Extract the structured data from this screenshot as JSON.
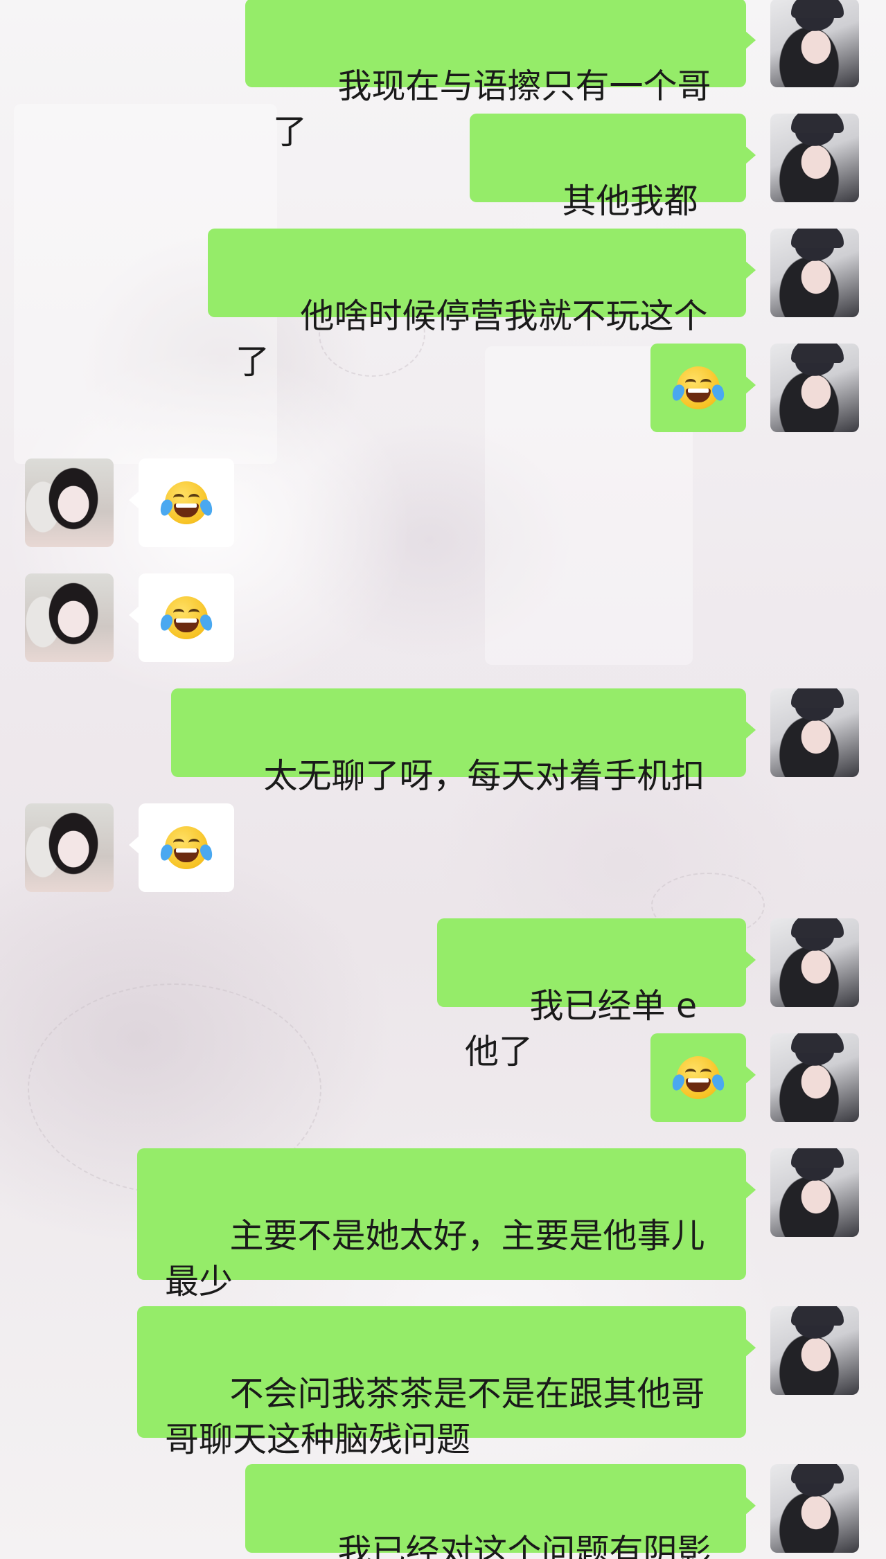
{
  "chat": {
    "messages": [
      {
        "side": "me",
        "type": "text",
        "text": "我现在与语擦只有一个哥了"
      },
      {
        "side": "me",
        "type": "text",
        "text": "其他我都删了"
      },
      {
        "side": "me",
        "type": "text",
        "text": "他啥时候停营我就不玩这个了"
      },
      {
        "side": "me",
        "type": "emoji",
        "emoji": "face-with-tears-of-joy-icon"
      },
      {
        "side": "other",
        "type": "emoji",
        "emoji": "face-with-tears-of-joy-icon"
      },
      {
        "side": "other",
        "type": "emoji",
        "emoji": "face-with-tears-of-joy-icon"
      },
      {
        "side": "me",
        "type": "text",
        "text": "太无聊了呀，每天对着手机扣字"
      },
      {
        "side": "other",
        "type": "emoji",
        "emoji": "face-with-tears-of-joy-icon"
      },
      {
        "side": "me",
        "type": "text",
        "text": "我已经单 e 他了"
      },
      {
        "side": "me",
        "type": "emoji",
        "emoji": "face-with-tears-of-joy-icon"
      },
      {
        "side": "me",
        "type": "text",
        "text": "主要不是她太好，主要是他事儿最少"
      },
      {
        "side": "me",
        "type": "text",
        "text": "不会问我茶茶是不是在跟其他哥哥聊天这种脑残问题"
      },
      {
        "side": "me",
        "type": "text",
        "text": "我已经对这个问题有阴影了"
      }
    ]
  },
  "colors": {
    "my_bubble": "#95ec69",
    "other_bubble": "#ffffff",
    "text": "#1a1a1a"
  }
}
